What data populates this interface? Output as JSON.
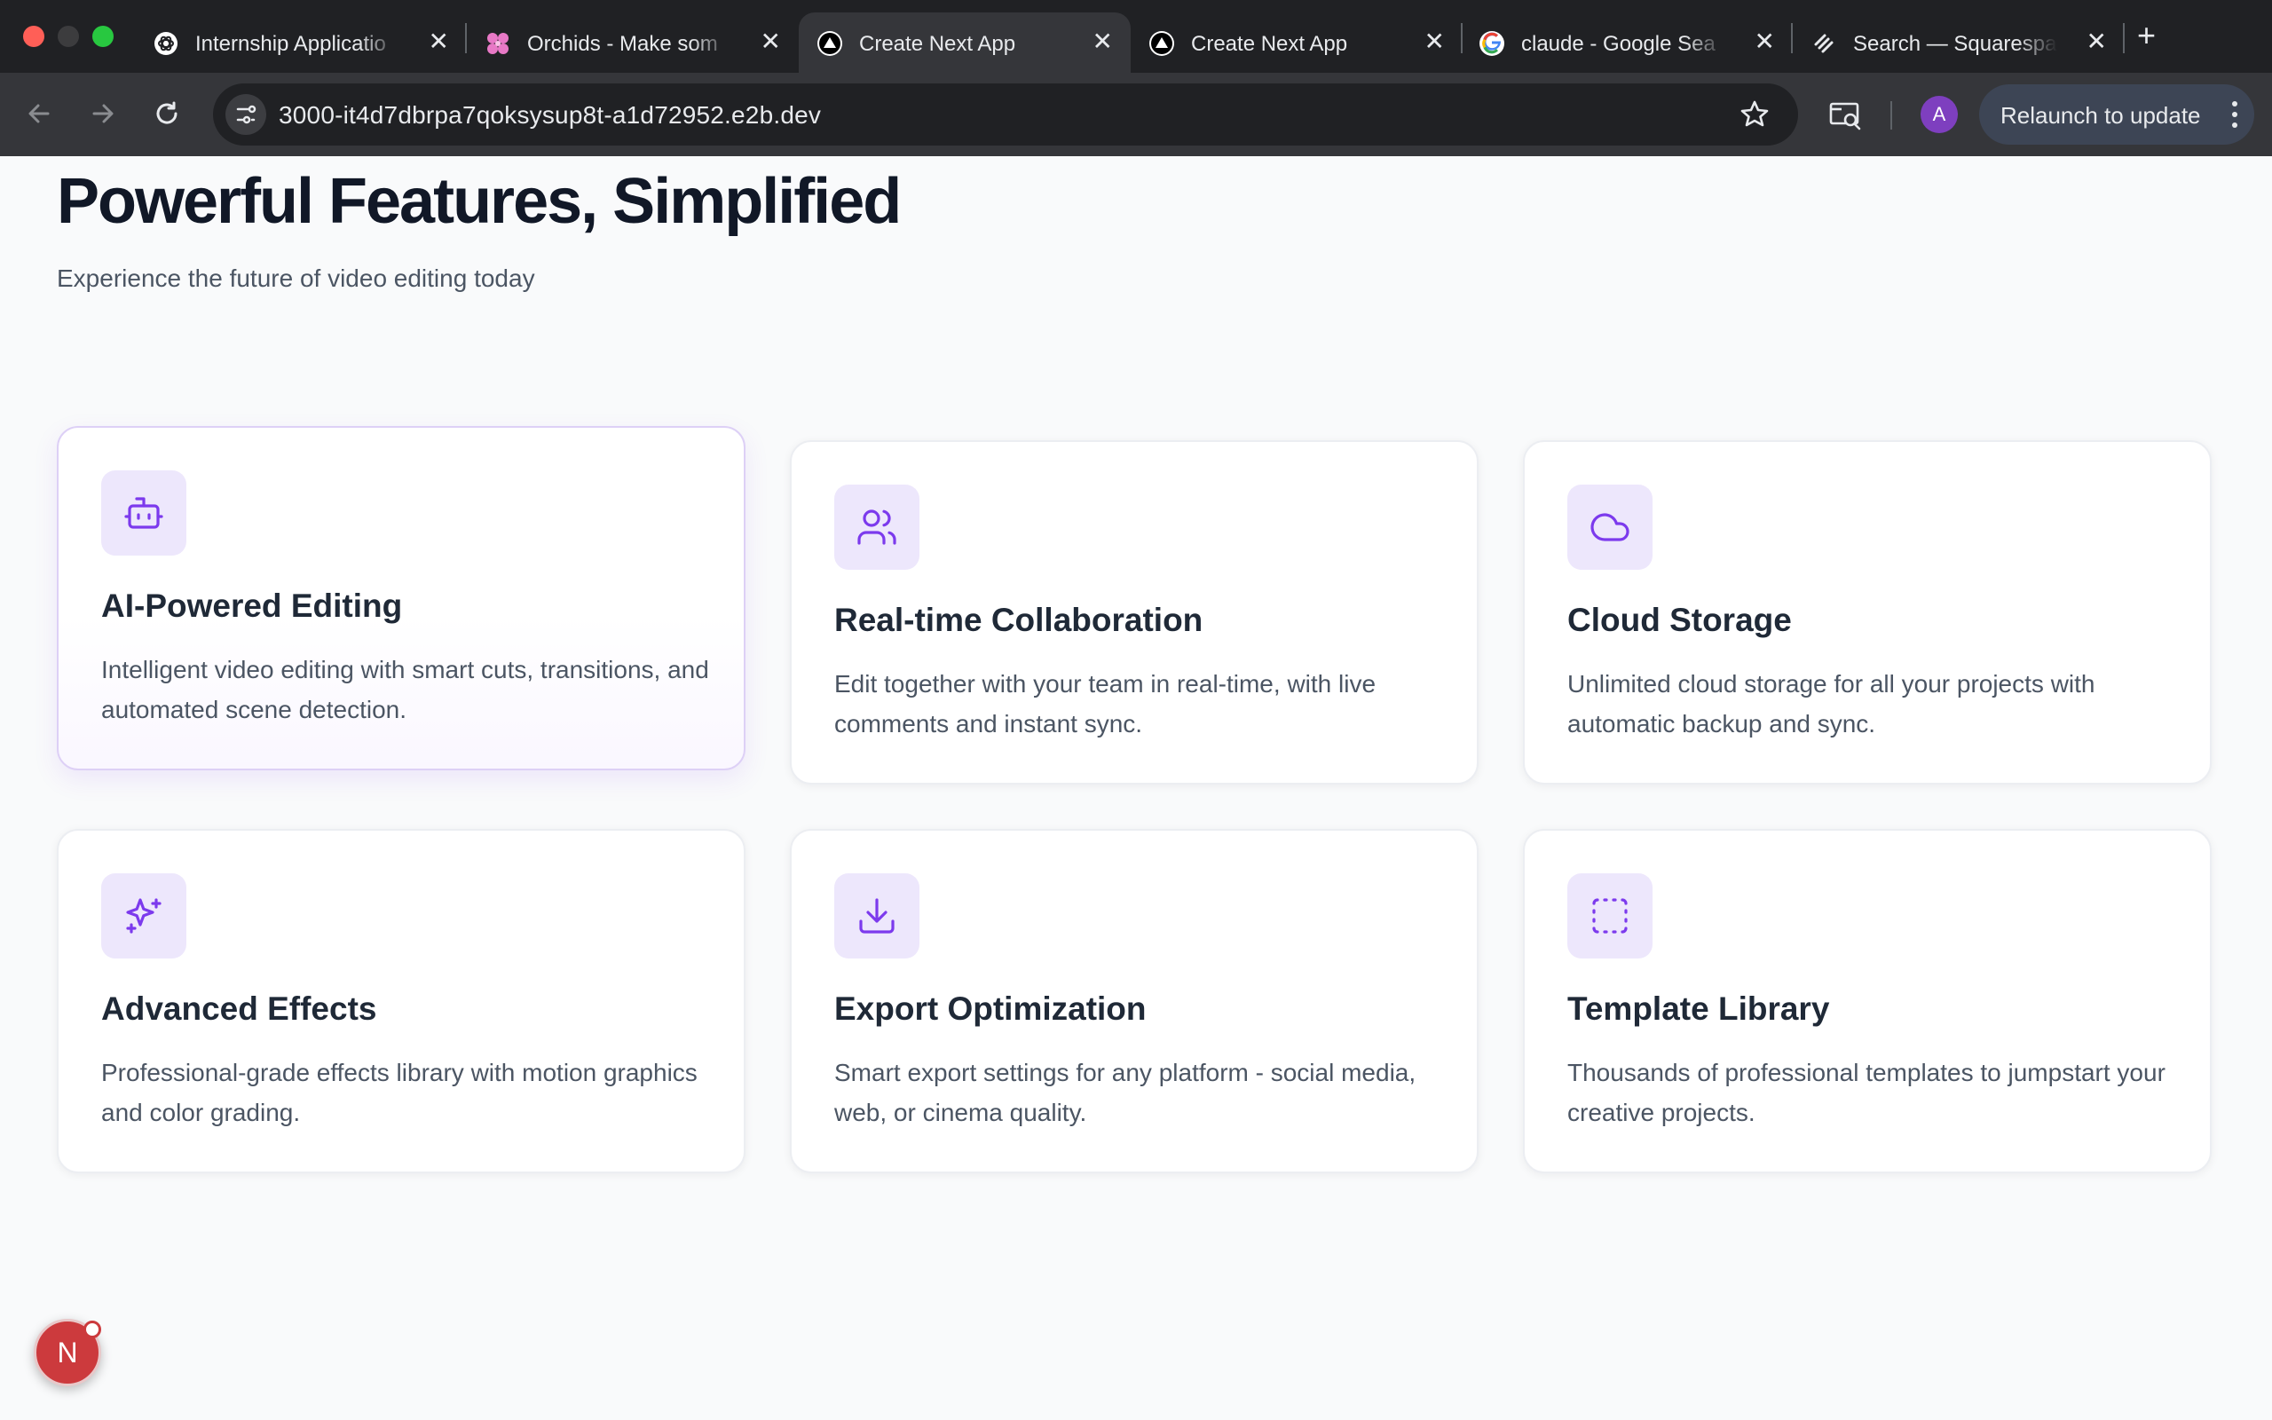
{
  "browser": {
    "tabs": [
      {
        "title": "Internship Applicatio",
        "favicon": "openai-icon",
        "active": false
      },
      {
        "title": "Orchids - Make som",
        "favicon": "orchid-icon",
        "active": false
      },
      {
        "title": "Create Next App",
        "favicon": "vercel-icon",
        "active": true
      },
      {
        "title": "Create Next App",
        "favicon": "vercel-icon",
        "active": false
      },
      {
        "title": "claude - Google Sea",
        "favicon": "google-icon",
        "active": false
      },
      {
        "title": "Search — Squarespa",
        "favicon": "squarespace-icon",
        "active": false
      }
    ],
    "close_glyph": "✕",
    "new_tab_glyph": "+",
    "url": "3000-it4d7dbrpa7qoksysup8t-a1d72952.e2b.dev",
    "avatar_initial": "A",
    "relaunch_label": "Relaunch to update"
  },
  "page": {
    "title": "Powerful Features, Simplified",
    "subtitle": "Experience the future of video editing today"
  },
  "features": [
    {
      "title": "AI-Powered Editing",
      "description": "Intelligent video editing with smart cuts, transitions, and automated scene detection.",
      "icon": "bot-icon"
    },
    {
      "title": "Real-time Collaboration",
      "description": "Edit together with your team in real-time, with live comments and instant sync.",
      "icon": "users-icon"
    },
    {
      "title": "Cloud Storage",
      "description": "Unlimited cloud storage for all your projects with automatic backup and sync.",
      "icon": "cloud-icon"
    },
    {
      "title": "Advanced Effects",
      "description": "Professional-grade effects library with motion graphics and color grading.",
      "icon": "sparkles-icon"
    },
    {
      "title": "Export Optimization",
      "description": "Smart export settings for any platform - social media, web, or cinema quality.",
      "icon": "download-icon"
    },
    {
      "title": "Template Library",
      "description": "Thousands of professional templates to jumpstart your creative projects.",
      "icon": "dashed-square-icon"
    }
  ],
  "dev_badge": {
    "label": "N"
  },
  "colors": {
    "accent": "#7c3aed",
    "icon_bg": "#ede7fc",
    "heading": "#111827"
  }
}
